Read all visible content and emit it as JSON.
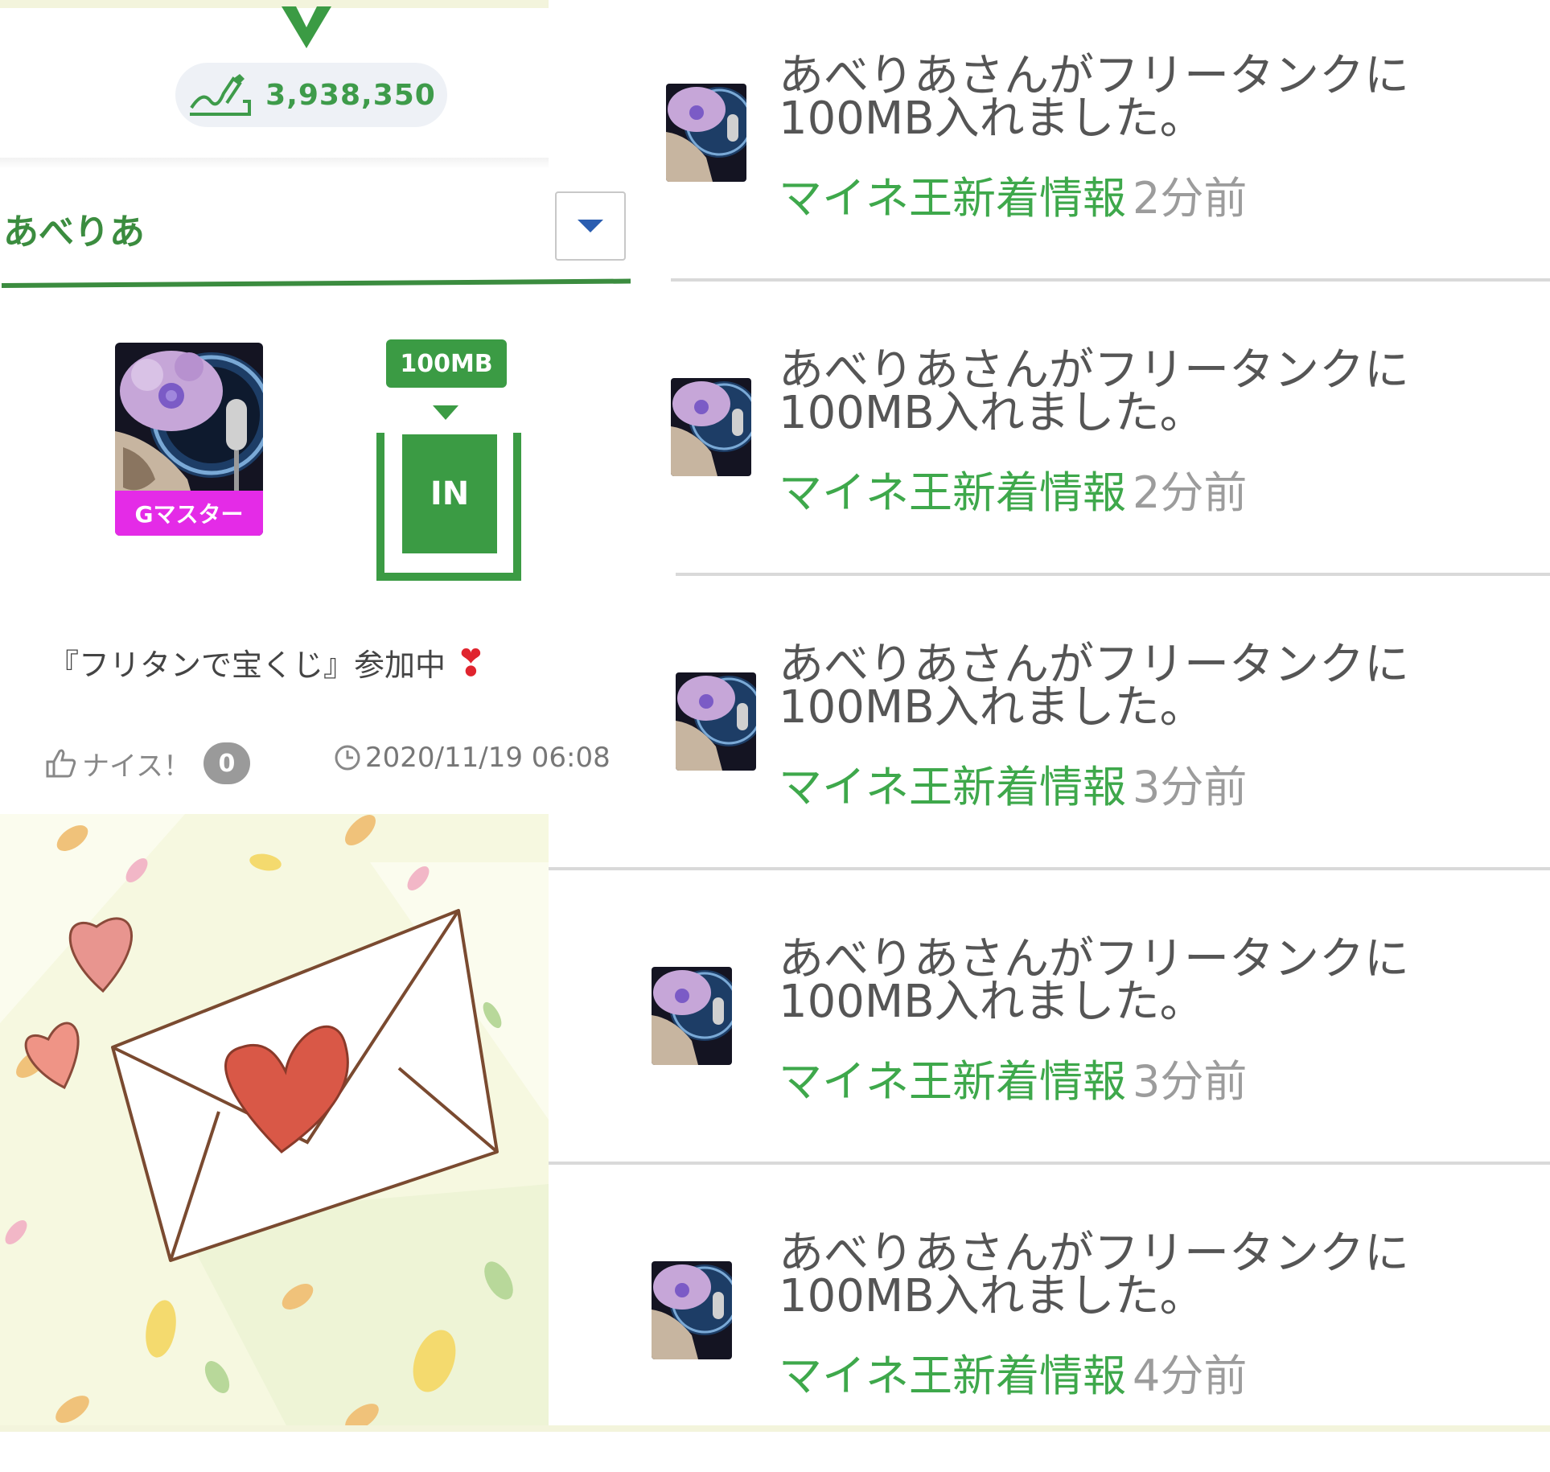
{
  "score": {
    "value": "3,938,350",
    "icon": "signature-icon"
  },
  "user": {
    "name": "あべりあ",
    "rank_badge": "Gマスター"
  },
  "tank": {
    "amount_label": "100MB",
    "status_label": "IN"
  },
  "post": {
    "text": "『フリタンで宝くじ』参加中",
    "emoji": "❣",
    "nice_label": "ナイス！",
    "nice_count": "0",
    "timestamp": "2020/11/19 06:08"
  },
  "feed": {
    "items": [
      {
        "message": "あべりあさんがフリータンクに100MB入れました。",
        "source": "マイネ王新着情報",
        "time_ago": "2分前"
      },
      {
        "message": "あべりあさんがフリータンクに100MB入れました。",
        "source": "マイネ王新着情報",
        "time_ago": "2分前"
      },
      {
        "message": "あべりあさんがフリータンクに100MB入れました。",
        "source": "マイネ王新着情報",
        "time_ago": "3分前"
      },
      {
        "message": "あべりあさんがフリータンクに100MB入れました。",
        "source": "マイネ王新着情報",
        "time_ago": "3分前"
      },
      {
        "message": "あべりあさんがフリータンクに100MB入れました。",
        "source": "マイネ王新着情報",
        "time_ago": "4分前"
      }
    ]
  },
  "colors": {
    "brand_green": "#3b8c3f",
    "tank_green": "#3b9b44",
    "link_green": "#3ea84b",
    "badge_magenta": "#e42be7"
  }
}
